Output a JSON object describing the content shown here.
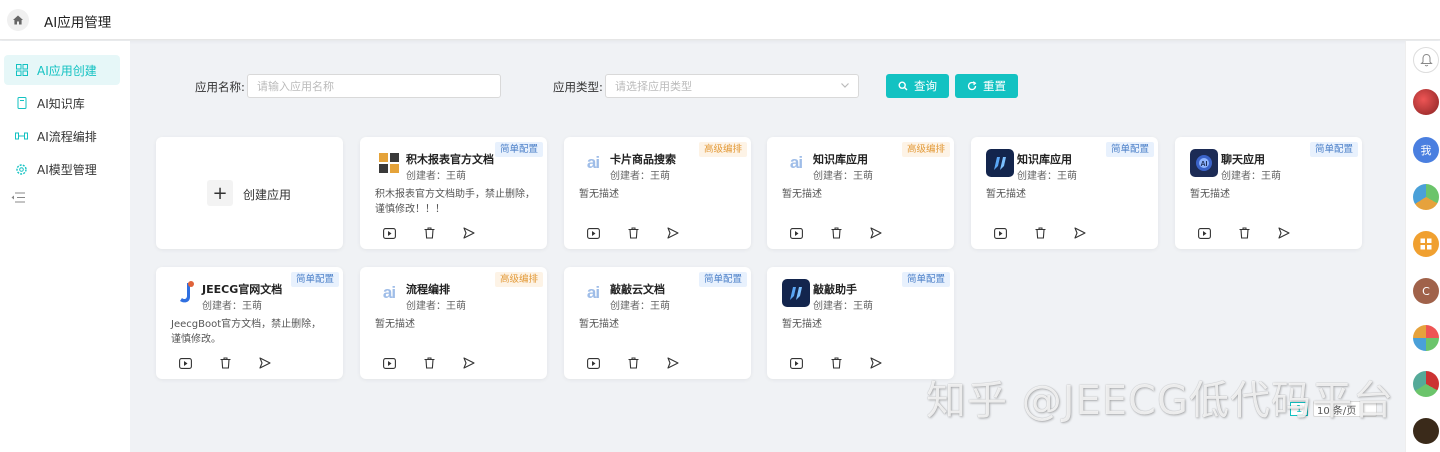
{
  "header": {
    "title": "AI应用管理"
  },
  "sidebar": {
    "items": [
      {
        "label": "AI应用创建",
        "icon": "grid-icon",
        "active": true
      },
      {
        "label": "AI知识库",
        "icon": "book-icon",
        "active": false
      },
      {
        "label": "AI流程编排",
        "icon": "flow-icon",
        "active": false
      },
      {
        "label": "AI模型管理",
        "icon": "gear-icon",
        "active": false
      }
    ]
  },
  "search": {
    "name_label": "应用名称:",
    "name_placeholder": "请输入应用名称",
    "type_label": "应用类型:",
    "type_placeholder": "请选择应用类型",
    "query_label": "查询",
    "reset_label": "重置"
  },
  "create_label": "创建应用",
  "cards": [
    {
      "name": "积木报表官方文档",
      "creator": "创建者：王萌",
      "desc": "积木报表官方文档助手，禁止删除，谨慎修改！！！",
      "tag": "简单配置",
      "tag_type": "simple",
      "logo": "jimu-logo-icon"
    },
    {
      "name": "卡片商品搜索",
      "creator": "创建者：王萌",
      "desc": "暂无描述",
      "tag": "高级编排",
      "tag_type": "adv",
      "logo": "ai-logo-icon"
    },
    {
      "name": "知识库应用",
      "creator": "创建者：王萌",
      "desc": "暂无描述",
      "tag": "高级编排",
      "tag_type": "adv",
      "logo": "ai-logo-icon"
    },
    {
      "name": "知识库应用",
      "creator": "创建者：王萌",
      "desc": "暂无描述",
      "tag": "简单配置",
      "tag_type": "simple",
      "logo": "blue-app-icon"
    },
    {
      "name": "聊天应用",
      "creator": "创建者：王萌",
      "desc": "暂无描述",
      "tag": "简单配置",
      "tag_type": "simple",
      "logo": "chat-robot-icon"
    },
    {
      "name": "JEECG官网文档",
      "creator": "创建者：王萌",
      "desc": "JeecgBoot官方文档，禁止删除，谨慎修改。",
      "tag": "简单配置",
      "tag_type": "simple",
      "logo": "jeecg-logo-icon"
    },
    {
      "name": "流程编排",
      "creator": "创建者：王萌",
      "desc": "暂无描述",
      "tag": "高级编排",
      "tag_type": "adv",
      "logo": "ai-logo-icon"
    },
    {
      "name": "敲敲云文档",
      "creator": "创建者：王萌",
      "desc": "暂无描述",
      "tag": "简单配置",
      "tag_type": "simple",
      "logo": "ai-logo-icon"
    },
    {
      "name": "敲敲助手",
      "creator": "创建者：王萌",
      "desc": "暂无描述",
      "tag": "简单配置",
      "tag_type": "simple",
      "logo": "blue-app-icon"
    }
  ],
  "pagination": {
    "current": "1",
    "page_size": "10 条/页"
  },
  "watermark": "知乎 @JEECG低代码平台",
  "rail": {
    "me_label": "我",
    "c_label": "C"
  },
  "colors": {
    "accent": "#13c2c2",
    "simple_tag": "#4a7fc8",
    "adv_tag": "#e39b3a"
  }
}
